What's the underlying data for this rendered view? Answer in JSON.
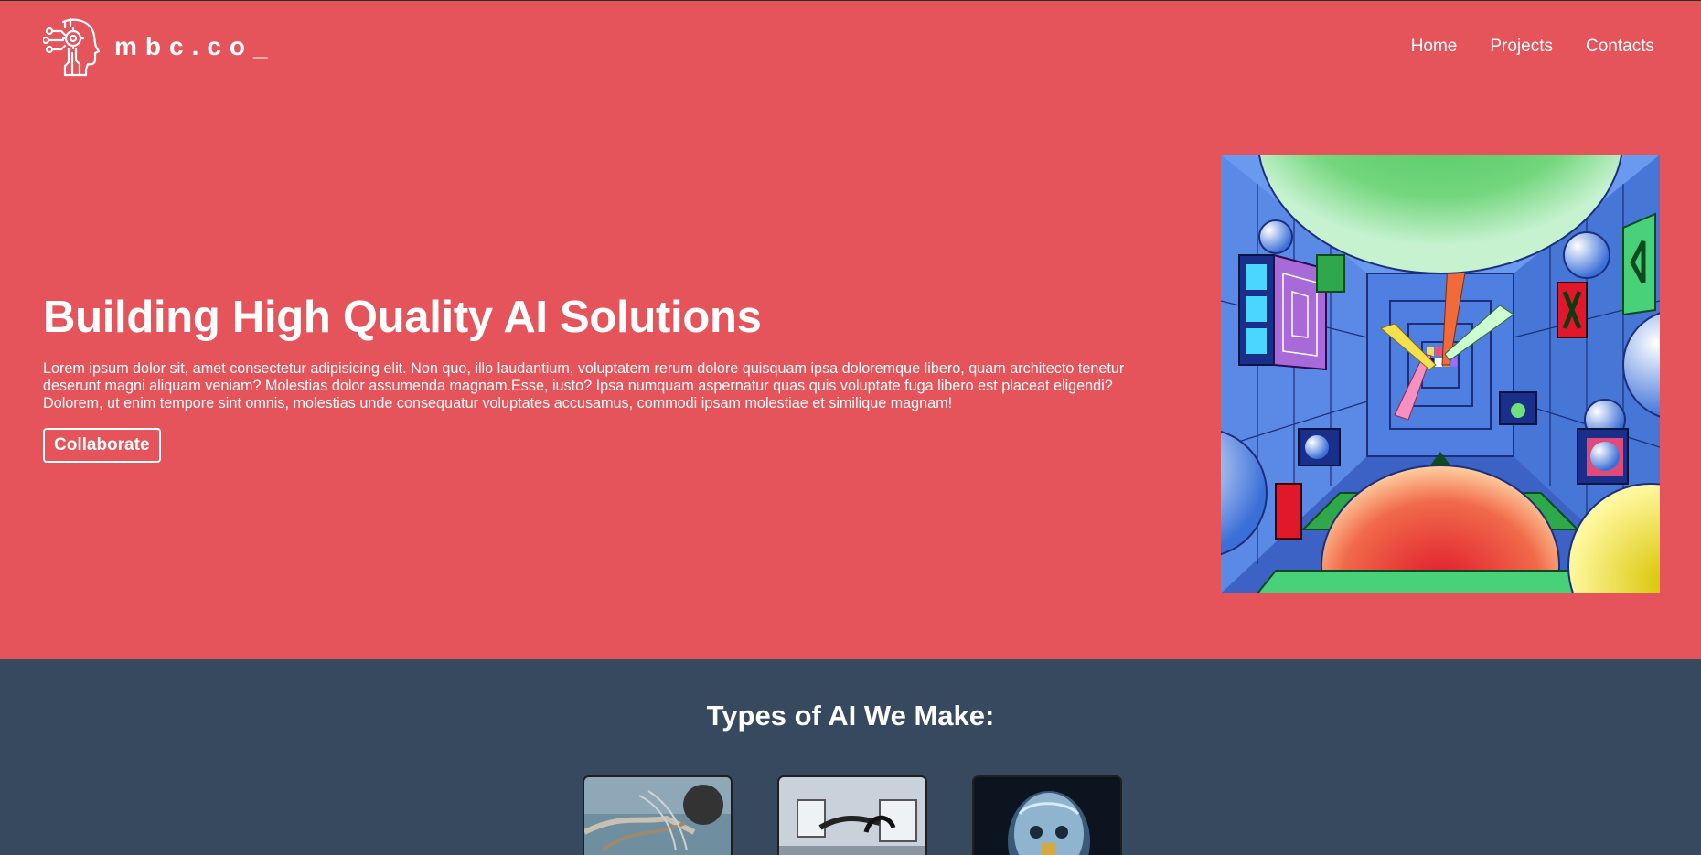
{
  "header": {
    "brand": "mbc.co_",
    "logo_icon": "robot-head-circuit-icon",
    "nav": [
      {
        "label": "Home"
      },
      {
        "label": "Projects"
      },
      {
        "label": "Contacts"
      }
    ]
  },
  "hero": {
    "title": "Building High Quality AI Solutions",
    "body": "Lorem ipsum dolor sit, amet consectetur adipisicing elit. Non quo, illo laudantium, voluptatem rerum dolore quisquam ipsa doloremque libero, quam architecto tenetur deserunt magni aliquam veniam? Molestias dolor assumenda magnam.Esse, iusto? Ipsa numquam aspernatur quas quis voluptate fuga libero est placeat eligendi? Dolorem, ut enim tempore sint omnis, molestias unde consequatur voluptates accusamus, commodi ipsam molestiae et similique magnam!",
    "button_label": "Collaborate",
    "image": "colorful-perspective-corridor-illustration"
  },
  "types": {
    "title": "Types of AI We Make:",
    "cards": [
      {
        "image": "robotic-arm-photo"
      },
      {
        "image": "industrial-robot-photo"
      },
      {
        "image": "robot-head-photo"
      }
    ]
  },
  "colors": {
    "hero_bg": "#E4545A",
    "section_bg": "#36495F",
    "text": "#FFFFFF"
  }
}
